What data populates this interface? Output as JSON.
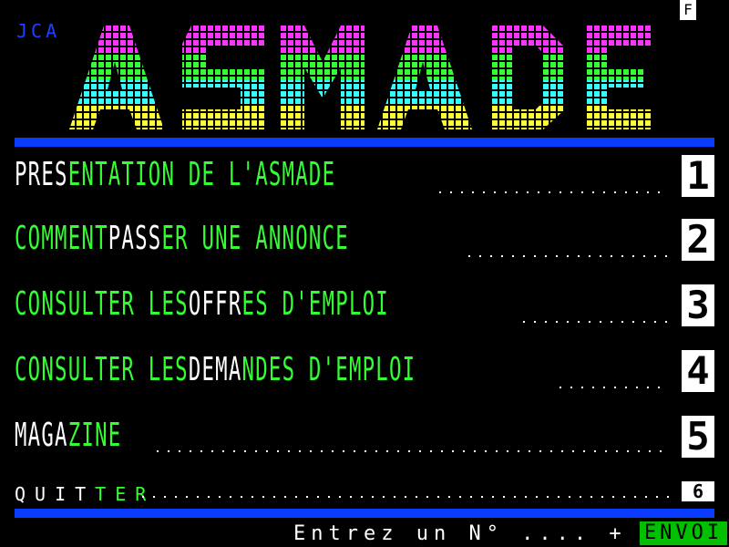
{
  "header": {
    "corner_label": "F",
    "tag": "JCA",
    "logo_text": "ASMADE"
  },
  "menu": [
    {
      "white": "PRES",
      "green": "ENTATION DE L'ASMADE",
      "num": "1"
    },
    {
      "white": "COMMENT PASS",
      "green": "ER UNE ANNONCE",
      "num": "2",
      "greenFirst": "COMMENT ",
      "mid": "PASS"
    },
    {
      "green1": "CONSULTER LES ",
      "white": "OFFR",
      "green2": "ES D'EMPLOI",
      "num": "3"
    },
    {
      "green1": "CONSULTER LES ",
      "white": "DEMA",
      "green2": "NDES D'EMPLOI",
      "num": "4"
    },
    {
      "white": "MAGA",
      "green": "ZINE",
      "num": "5"
    },
    {
      "white": "QUIT",
      "green": "TER",
      "num": "6"
    }
  ],
  "footer": {
    "prompt": "Entrez un N° .... +",
    "envoi": "ENVOI"
  },
  "colors": {
    "blue_bar": "#0a3cff",
    "green": "#33ff33",
    "envoi_bg": "#00c000"
  }
}
